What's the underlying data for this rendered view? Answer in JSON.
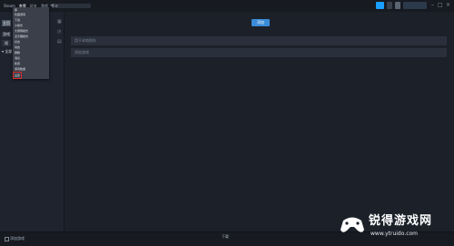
{
  "menubar": {
    "items": [
      {
        "label": "Steam"
      },
      {
        "label": "查看"
      },
      {
        "label": "好友"
      },
      {
        "label": "游戏"
      },
      {
        "label": "帮助"
      }
    ]
  },
  "sidebar": {
    "home_label": "主页",
    "games_label": "游戏",
    "search_label": "搜",
    "all_label": "▾ 全部"
  },
  "dropdown": {
    "items": [
      {
        "label": "库"
      },
      {
        "label": "隐藏游戏"
      },
      {
        "label": "下载"
      },
      {
        "label": "小模式"
      },
      {
        "label": "大屏幕模式"
      },
      {
        "label": "显示器模式"
      },
      {
        "label": "好友"
      },
      {
        "label": "动态"
      },
      {
        "label": "群聊"
      },
      {
        "label": "消息"
      },
      {
        "label": "新闻"
      },
      {
        "label": "游戏数据"
      },
      {
        "label": "设置"
      }
    ]
  },
  "main": {
    "button_label": "添加",
    "field1_placeholder": "用于本地保存",
    "field2_placeholder": "添加游戏"
  },
  "bottombar": {
    "left_text": "添加游戏",
    "center_text": "下载"
  },
  "watermark": {
    "name": "锐得游戏网",
    "url": "www.ytruido.com"
  },
  "colors": {
    "background": "#1b2029",
    "accent": "#3a8bd8",
    "highlight_box": "#d42a2a"
  }
}
